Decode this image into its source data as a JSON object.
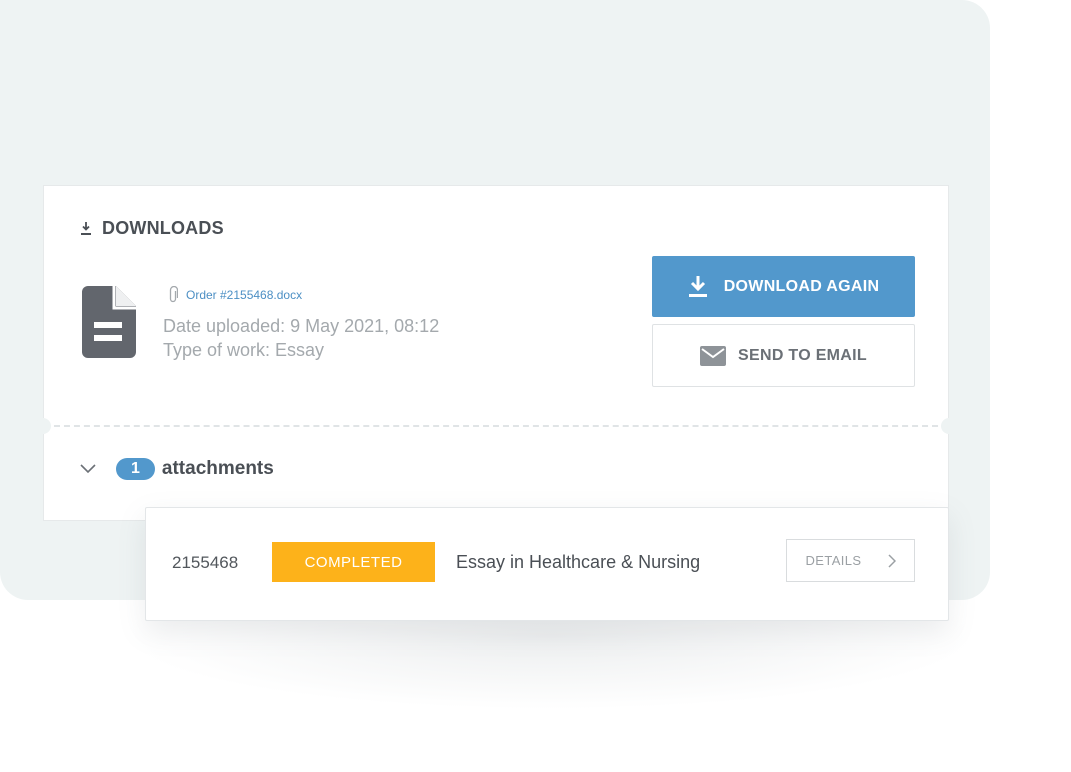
{
  "downloads": {
    "title": "DOWNLOADS",
    "file_name": "Order #2155468.docx",
    "date_uploaded": "Date uploaded: 9 May 2021, 08:12",
    "type_of_work": "Type of work: Essay",
    "download_again_label": "DOWNLOAD AGAIN",
    "send_to_email_label": "SEND TO EMAIL",
    "attachments_count": "1",
    "attachments_label": "attachments"
  },
  "order_row": {
    "order_id": "2155468",
    "status": "COMPLETED",
    "title": "Essay in Healthcare & Nursing",
    "details_label": "DETAILS"
  },
  "colors": {
    "primary": "#5298cc",
    "status_completed": "#fdb21a",
    "backdrop": "#eef3f3"
  },
  "icons": [
    "download-icon",
    "document-icon",
    "paperclip-icon",
    "mail-icon",
    "chevron-down-icon",
    "chevron-right-icon"
  ]
}
